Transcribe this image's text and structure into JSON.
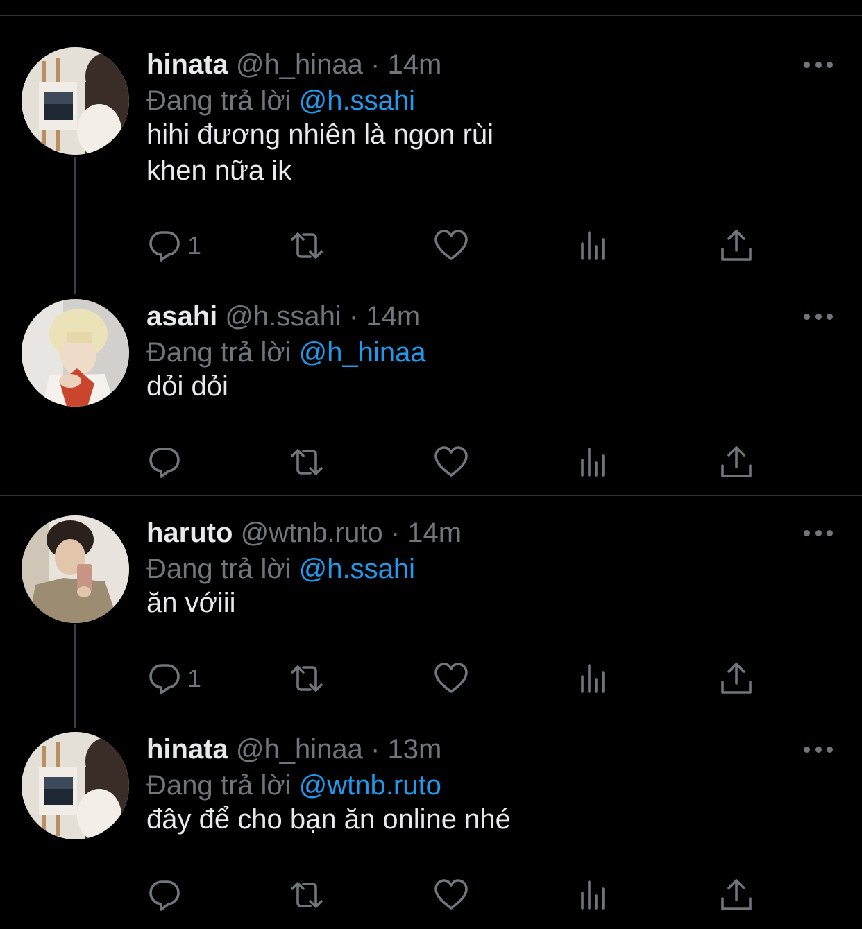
{
  "replying_prefix": "Đang trả lời",
  "tweets": [
    {
      "name": "hinata",
      "handle": "@h_hinaa",
      "time": "· 14m",
      "reply_to": "@h.ssahi",
      "text": "hihi đương nhiên là ngon rùi\nkhen nữa ik",
      "reply_count": "1"
    },
    {
      "name": "asahi",
      "handle": "@h.ssahi",
      "time": "· 14m",
      "reply_to": "@h_hinaa",
      "text": "dỏi dỏi",
      "reply_count": ""
    },
    {
      "name": "haruto",
      "handle": "@wtnb.ruto",
      "time": "· 14m",
      "reply_to": "@h.ssahi",
      "text": "ăn vớiii",
      "reply_count": "1"
    },
    {
      "name": "hinata",
      "handle": "@h_hinaa",
      "time": "· 13m",
      "reply_to": "@wtnb.ruto",
      "text": "đây để cho bạn ăn online nhé",
      "reply_count": ""
    }
  ],
  "colors": {
    "background": "#000000",
    "text": "#e7e9ea",
    "muted": "#71767b",
    "link": "#1d9bf0",
    "divider": "#2f3336"
  }
}
